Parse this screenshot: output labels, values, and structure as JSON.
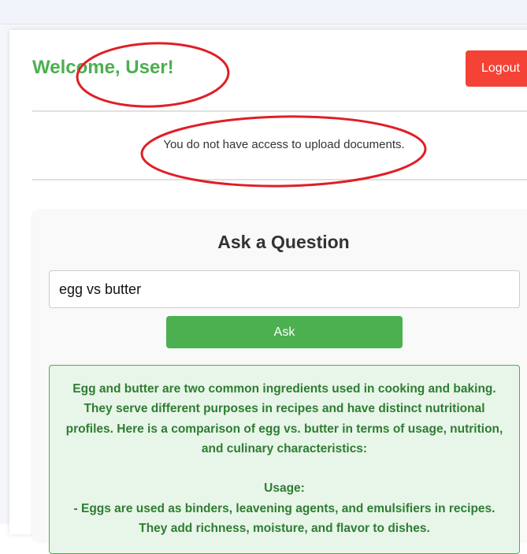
{
  "header": {
    "welcome_text": "Welcome, User!",
    "logout_label": "Logout"
  },
  "notice": {
    "text": "You do not have access to upload documents."
  },
  "qa": {
    "title": "Ask a Question",
    "input_value": "egg vs butter",
    "ask_label": "Ask",
    "answer_paragraphs": [
      "Egg and butter are two common ingredients used in cooking and baking. They serve different purposes in recipes and have distinct nutritional profiles. Here is a comparison of egg vs. butter in terms of usage, nutrition, and culinary characteristics:",
      "",
      "Usage:",
      "- Eggs are used as binders, leavening agents, and emulsifiers in recipes.",
      "They add richness, moisture, and flavor to dishes."
    ]
  },
  "colors": {
    "accent_green": "#4caf50",
    "logout_red": "#f44336",
    "answer_bg": "#e8f5e9",
    "answer_text": "#2e7d32",
    "annotation_red": "#e01e26"
  }
}
